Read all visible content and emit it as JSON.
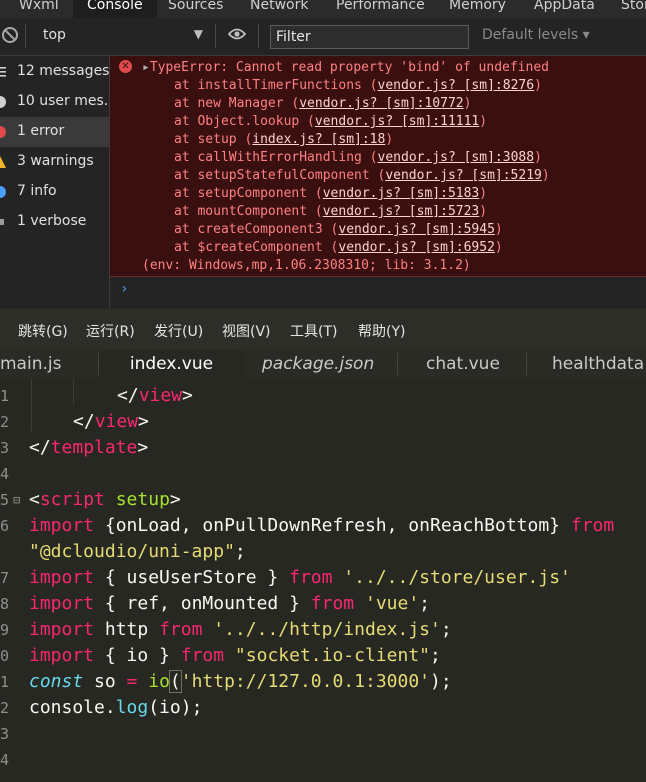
{
  "devtools": {
    "tabs": [
      "Wxml",
      "Console",
      "Sources",
      "Network",
      "Performance",
      "Memory",
      "AppData",
      "Stor"
    ],
    "active_tab": "Console"
  },
  "toolbar": {
    "context": "top",
    "filter_placeholder": "Filter",
    "levels": "Default levels ▾"
  },
  "sidebar": {
    "items": [
      {
        "label": "12 messages",
        "icon": "list-icon"
      },
      {
        "label": "10 user mes...",
        "icon": "user-icon"
      },
      {
        "label": "1 error",
        "icon": "error-icon"
      },
      {
        "label": "3 warnings",
        "icon": "warning-icon"
      },
      {
        "label": "7 info",
        "icon": "info-icon"
      },
      {
        "label": "1 verbose",
        "icon": "verbose-icon"
      }
    ]
  },
  "console": {
    "error_title": "TypeError: Cannot read property 'bind' of undefined",
    "stack": [
      {
        "fn": "installTimerFunctions",
        "file": "vendor.js? [sm]:8276"
      },
      {
        "fn": "new Manager",
        "file": "vendor.js? [sm]:10772"
      },
      {
        "fn": "Object.lookup",
        "file": "vendor.js? [sm]:11111"
      },
      {
        "fn": "setup",
        "file": "index.js? [sm]:18"
      },
      {
        "fn": "callWithErrorHandling",
        "file": "vendor.js? [sm]:3088"
      },
      {
        "fn": "setupStatefulComponent",
        "file": "vendor.js? [sm]:5219"
      },
      {
        "fn": "setupComponent",
        "file": "vendor.js? [sm]:5183"
      },
      {
        "fn": "mountComponent",
        "file": "vendor.js? [sm]:5723"
      },
      {
        "fn": "createComponent3",
        "file": "vendor.js? [sm]:5945"
      },
      {
        "fn": "$createComponent",
        "file": "vendor.js? [sm]:6952"
      }
    ],
    "env": "(env: Windows,mp,1.06.2308310; lib: 3.1.2)",
    "prompt": "›"
  },
  "menu": [
    "跳转(G)",
    "运行(R)",
    "发行(U)",
    "视图(V)",
    "工具(T)",
    "帮助(Y)"
  ],
  "file_tabs": [
    "main.js",
    "index.vue",
    "package.json",
    "chat.vue",
    "healthdata.v"
  ],
  "active_file": "index.vue",
  "line_numbers": [
    "1",
    "2",
    "3",
    "4",
    "5",
    "6",
    "",
    "7",
    "8",
    "9",
    "0",
    "1",
    "2",
    "3",
    "4"
  ],
  "code": {
    "l1_close": "</",
    "l1_tag": "view",
    "l1_end": ">",
    "l2_close": "</",
    "l2_tag": "view",
    "l2_end": ">",
    "l3_close": "</",
    "l3_tag": "template",
    "l3_end": ">",
    "l5_open": "<",
    "l5_tag": "script",
    "l5_attr": "setup",
    "l5_end": ">",
    "l6_kw": "import",
    "l6_rest": " {onLoad, onPullDownRefresh, onReachBottom} ",
    "l6_from": "from",
    "l6b_str": "\"@dcloudio/uni-app\"",
    "l6b_end": ";",
    "l7_kw": "import",
    "l7_rest": " { useUserStore } ",
    "l7_from": "from",
    "l7_str": " '../../store/user.js'",
    "l8_kw": "import",
    "l8_rest": " { ref, onMounted } ",
    "l8_from": "from",
    "l8_str": " 'vue'",
    "l8_end": ";",
    "l9_kw": "import",
    "l9_rest": " http ",
    "l9_from": "from",
    "l9_str": " '../../http/index.js'",
    "l9_end": ";",
    "l10_kw": "import",
    "l10_rest": " { io } ",
    "l10_from": "from",
    "l10_str": " \"socket.io-client\"",
    "l10_end": ";",
    "l11_kw": "const",
    "l11_var": " so ",
    "l11_op": "=",
    "l11_fn": " io",
    "l11_p": "(",
    "l11_str": "'http://127.0.0.1:3000'",
    "l11_end": ");",
    "l12_obj": "console.",
    "l12_fn": "log",
    "l12_rest": "(io);"
  }
}
